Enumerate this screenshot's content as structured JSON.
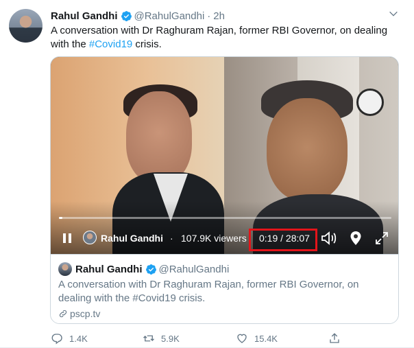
{
  "tweet": {
    "author_name": "Rahul Gandhi",
    "handle": "@RahulGandhi",
    "separator": "·",
    "time": "2h",
    "text_before": "A conversation with Dr Raghuram Rajan, former RBI Governor, on dealing with the ",
    "hashtag": "#Covid19",
    "text_after": " crisis."
  },
  "video": {
    "broadcaster": "Rahul Gandhi",
    "separator": "·",
    "viewers": "107.9K viewers",
    "timecode": "0:19 / 28:07",
    "progress": 0.011
  },
  "card": {
    "author_name": "Rahul Gandhi",
    "handle": "@RahulGandhi",
    "text": "A conversation with Dr Raghuram Rajan, former RBI Governor, on dealing with the #Covid19 crisis.",
    "link": "pscp.tv"
  },
  "actions": {
    "replies": "1.4K",
    "retweets": "5.9K",
    "likes": "15.4K"
  },
  "colors": {
    "accent": "#1da1f2",
    "highlight_box": "#e3141a",
    "muted_text": "#657786"
  },
  "icons": [
    "verified-badge-icon",
    "chevron-down-icon",
    "pause-icon",
    "volume-icon",
    "periscope-pin-icon",
    "expand-icon",
    "link-icon",
    "reply-icon",
    "retweet-icon",
    "like-icon",
    "share-icon"
  ]
}
